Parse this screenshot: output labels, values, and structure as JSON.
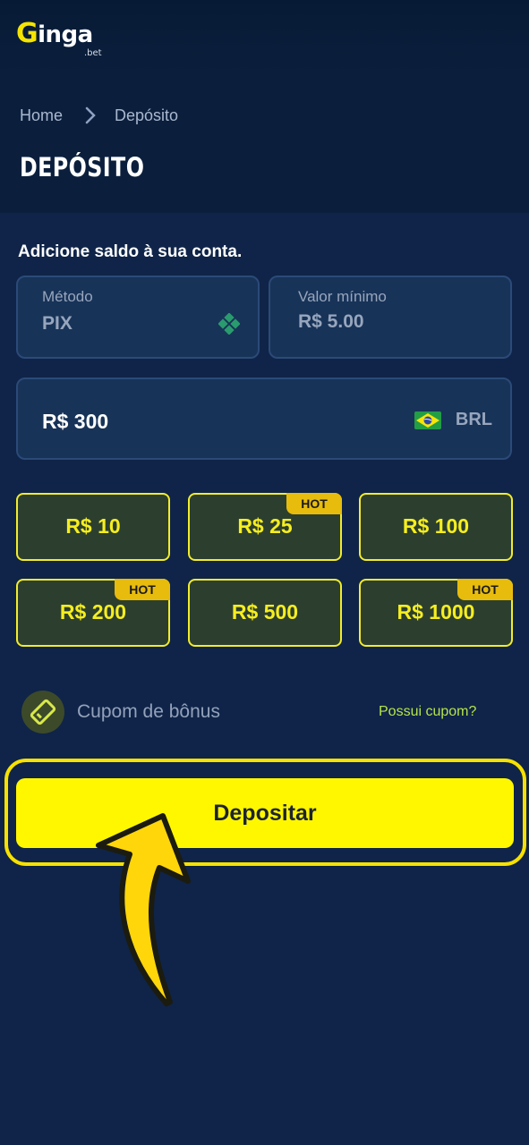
{
  "brand": {
    "logo_main": "Ginga",
    "logo_sub": ".bet"
  },
  "breadcrumb": {
    "home": "Home",
    "separator": "›",
    "current": "Depósito"
  },
  "page": {
    "title": "DEPÓSITO",
    "subtitle": "Adicione saldo à sua conta."
  },
  "method": {
    "label": "Método",
    "value": "PIX",
    "icon": "pix-icon"
  },
  "minimum": {
    "label": "Valor mínimo",
    "value": "R$ 5.00"
  },
  "amount": {
    "value": "R$ 300",
    "currency": "BRL",
    "flag_icon": "brazil-flag-icon"
  },
  "presets": [
    {
      "label": "R$ 10",
      "hot": ""
    },
    {
      "label": "R$ 25",
      "hot": "HOT"
    },
    {
      "label": "R$ 100",
      "hot": ""
    },
    {
      "label": "R$ 200",
      "hot": "HOT"
    },
    {
      "label": "R$ 500",
      "hot": ""
    },
    {
      "label": "R$ 1000",
      "hot": "HOT"
    }
  ],
  "coupon": {
    "label": "Cupom de bônus",
    "link": "Possui cupom?",
    "icon": "ticket-icon"
  },
  "action": {
    "deposit_label": "Depositar"
  },
  "colors": {
    "background": "#0f2448",
    "accent_yellow": "#fff700",
    "preset_border": "#f3ec2c",
    "hot_badge": "#e8bc0c",
    "link_green": "#b6e44a"
  }
}
